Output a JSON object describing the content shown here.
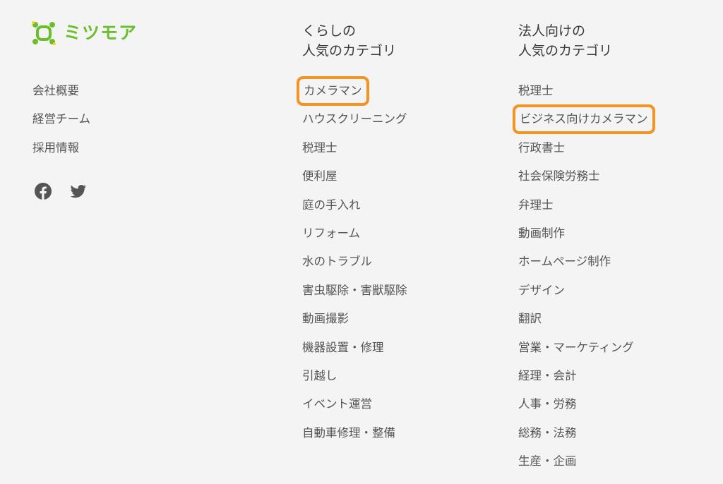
{
  "brand": {
    "logo_text": "ミツモア",
    "brand_color": "#6cbf2c"
  },
  "company_links": [
    {
      "label": "会社概要"
    },
    {
      "label": "経営チーム"
    },
    {
      "label": "採用情報"
    }
  ],
  "social": {
    "icons": [
      "facebook-icon",
      "twitter-icon"
    ]
  },
  "personal_categories": {
    "heading_line1": "くらしの",
    "heading_line2": "人気のカテゴリ",
    "items": [
      {
        "label": "カメラマン",
        "highlighted": true
      },
      {
        "label": "ハウスクリーニング"
      },
      {
        "label": "税理士"
      },
      {
        "label": "便利屋"
      },
      {
        "label": "庭の手入れ"
      },
      {
        "label": "リフォーム"
      },
      {
        "label": "水のトラブル"
      },
      {
        "label": "害虫駆除・害獣駆除"
      },
      {
        "label": "動画撮影"
      },
      {
        "label": "機器設置・修理"
      },
      {
        "label": "引越し"
      },
      {
        "label": "イベント運営"
      },
      {
        "label": "自動車修理・整備"
      }
    ]
  },
  "business_categories": {
    "heading_line1": "法人向けの",
    "heading_line2": "人気のカテゴリ",
    "items": [
      {
        "label": "税理士"
      },
      {
        "label": "ビジネス向けカメラマン",
        "highlighted": true
      },
      {
        "label": "行政書士"
      },
      {
        "label": "社会保険労務士"
      },
      {
        "label": "弁理士"
      },
      {
        "label": "動画制作"
      },
      {
        "label": "ホームページ制作"
      },
      {
        "label": "デザイン"
      },
      {
        "label": "翻訳"
      },
      {
        "label": "営業・マーケティング"
      },
      {
        "label": "経理・会計"
      },
      {
        "label": "人事・労務"
      },
      {
        "label": "総務・法務"
      },
      {
        "label": "生産・企画"
      }
    ]
  },
  "colors": {
    "background": "#f4f4f4",
    "text": "#555555",
    "highlight_outline": "#f39422"
  }
}
